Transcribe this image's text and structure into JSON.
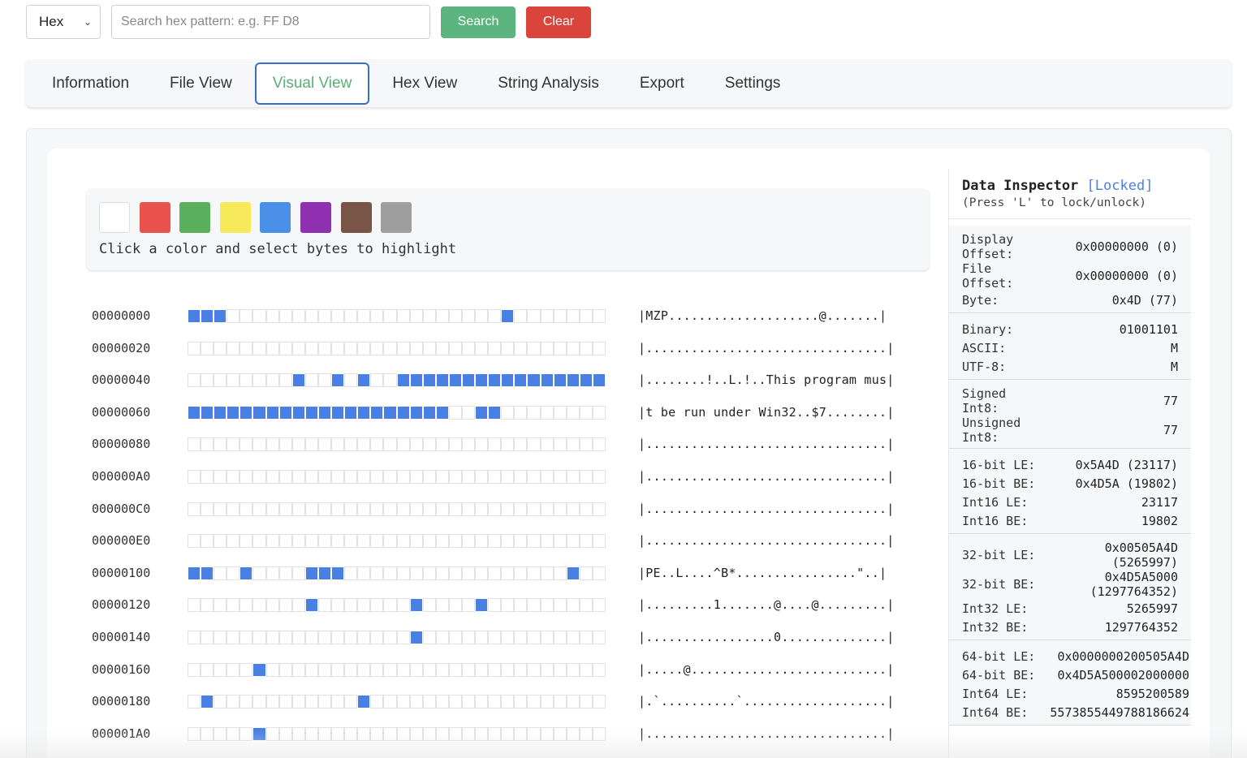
{
  "toolbar": {
    "mode": "Hex",
    "search_placeholder": "Search hex pattern: e.g. FF D8",
    "search_label": "Search",
    "clear_label": "Clear"
  },
  "tabs": [
    {
      "label": "Information",
      "active": false
    },
    {
      "label": "File View",
      "active": false
    },
    {
      "label": "Visual View",
      "active": true
    },
    {
      "label": "Hex View",
      "active": false
    },
    {
      "label": "String Analysis",
      "active": false
    },
    {
      "label": "Export",
      "active": false
    },
    {
      "label": "Settings",
      "active": false
    }
  ],
  "palette": {
    "colors": [
      "#ffffff",
      "#e9534b",
      "#5caf5c",
      "#f7ea5a",
      "#4a90e8",
      "#8f30b0",
      "#795548",
      "#9e9e9e"
    ],
    "hint": "Click a color and select bytes to highlight"
  },
  "colors": {
    "byte_on": "#4a80e4",
    "accent_green": "#5cb57e",
    "accent_red": "#d9443b",
    "lock_blue": "#4a80e4"
  },
  "rows": [
    {
      "addr": "00000000",
      "ascii": "|MZP....................@.......|",
      "on": [
        0,
        1,
        2,
        24
      ]
    },
    {
      "addr": "00000020",
      "ascii": "|................................|",
      "on": []
    },
    {
      "addr": "00000040",
      "ascii": "|........!..L.!..This program mus|",
      "on": [
        8,
        11,
        13,
        16,
        17,
        18,
        19,
        20,
        21,
        22,
        23,
        24,
        25,
        26,
        27,
        28,
        29,
        30,
        31
      ]
    },
    {
      "addr": "00000060",
      "ascii": "|t be run under Win32..$7........|",
      "on": [
        0,
        1,
        2,
        3,
        4,
        5,
        6,
        7,
        8,
        9,
        10,
        11,
        12,
        13,
        14,
        15,
        16,
        17,
        18,
        19,
        22,
        23
      ]
    },
    {
      "addr": "00000080",
      "ascii": "|................................|",
      "on": []
    },
    {
      "addr": "000000A0",
      "ascii": "|................................|",
      "on": []
    },
    {
      "addr": "000000C0",
      "ascii": "|................................|",
      "on": []
    },
    {
      "addr": "000000E0",
      "ascii": "|................................|",
      "on": []
    },
    {
      "addr": "00000100",
      "ascii": "|PE..L....^B*................\"..|",
      "on": [
        0,
        1,
        4,
        9,
        10,
        11,
        29
      ]
    },
    {
      "addr": "00000120",
      "ascii": "|.........1.......@....@.........|",
      "on": [
        9,
        17,
        22
      ]
    },
    {
      "addr": "00000140",
      "ascii": "|.................0..............|",
      "on": [
        17
      ]
    },
    {
      "addr": "00000160",
      "ascii": "|.....@..........................|",
      "on": [
        5
      ]
    },
    {
      "addr": "00000180",
      "ascii": "|.`..........`...................|",
      "on": [
        1,
        13
      ]
    },
    {
      "addr": "000001A0",
      "ascii": "|................................|",
      "on": [
        5
      ]
    }
  ],
  "inspector": {
    "title": "Data Inspector",
    "lock_state": "[Locked]",
    "hint": "(Press 'L' to lock/unlock)",
    "groups": [
      [
        {
          "label": "Display Offset:",
          "value": "0x00000000 (0)"
        },
        {
          "label": "File Offset:",
          "value": "0x00000000 (0)"
        },
        {
          "label": "Byte:",
          "value": "0x4D (77)"
        }
      ],
      [
        {
          "label": "Binary:",
          "value": "01001101"
        },
        {
          "label": "ASCII:",
          "value": "M"
        },
        {
          "label": "UTF-8:",
          "value": "M"
        }
      ],
      [
        {
          "label": "Signed Int8:",
          "value": "77"
        },
        {
          "label": "Unsigned Int8:",
          "value": "77"
        }
      ],
      [
        {
          "label": "16-bit LE:",
          "value": "0x5A4D (23117)"
        },
        {
          "label": "16-bit BE:",
          "value": "0x4D5A (19802)"
        },
        {
          "label": "Int16 LE:",
          "value": "23117"
        },
        {
          "label": "Int16 BE:",
          "value": "19802"
        }
      ],
      [
        {
          "label": "32-bit LE:",
          "value": "0x00505A4D (5265997)"
        },
        {
          "label": "32-bit BE:",
          "value": "0x4D5A5000 (1297764352)"
        },
        {
          "label": "Int32 LE:",
          "value": "5265997"
        },
        {
          "label": "Int32 BE:",
          "value": "1297764352"
        }
      ],
      [
        {
          "label": "64-bit LE:",
          "value": "0x0000000200505A4D"
        },
        {
          "label": "64-bit BE:",
          "value": "0x4D5A500002000000"
        },
        {
          "label": "Int64 LE:",
          "value": "8595200589"
        },
        {
          "label": "Int64 BE:",
          "value": "5573855449788186624"
        }
      ]
    ]
  }
}
